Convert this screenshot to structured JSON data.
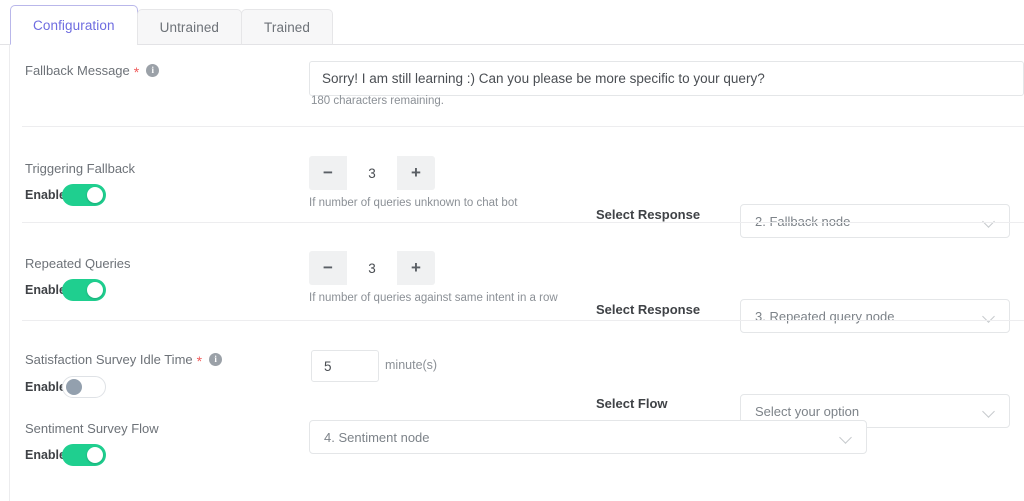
{
  "tabs": [
    {
      "label": "Configuration",
      "active": true
    },
    {
      "label": "Untrained",
      "active": false
    },
    {
      "label": "Trained",
      "active": false
    }
  ],
  "fallback_message": {
    "label": "Fallback Message",
    "required_marker": "*",
    "info_glyph": "i",
    "value": "Sorry! I am still learning :) Can you please be more specific to your query?",
    "helper": "180 characters remaining."
  },
  "triggering_fallback": {
    "label": "Triggering Fallback",
    "enable_label": "Enable",
    "enabled": true,
    "stepper": {
      "minus": "−",
      "value": "3",
      "plus": "+"
    },
    "helper": "If number of queries unknown to chat bot",
    "response_label": "Select Response",
    "response_value": "2. Fallback node"
  },
  "repeated_queries": {
    "label": "Repeated Queries",
    "enable_label": "Enable",
    "enabled": true,
    "stepper": {
      "minus": "−",
      "value": "3",
      "plus": "+"
    },
    "helper": "If number of queries against same intent in a row",
    "response_label": "Select Response",
    "response_value": "3. Repeated query node"
  },
  "satisfaction_survey": {
    "label": "Satisfaction Survey Idle Time",
    "required_marker": "*",
    "info_glyph": "i",
    "enable_label": "Enable",
    "enabled": false,
    "minutes_value": "5",
    "unit": "minute(s)",
    "flow_label": "Select Flow",
    "flow_value": "Select your option"
  },
  "sentiment_survey": {
    "label": "Sentiment Survey Flow",
    "enable_label": "Enable",
    "enabled": true,
    "flow_value": "4. Sentiment node"
  },
  "colors": {
    "accent_purple": "#6e6ce0",
    "toggle_on_green": "#1fcf8f",
    "required_red": "#f05b5b"
  }
}
